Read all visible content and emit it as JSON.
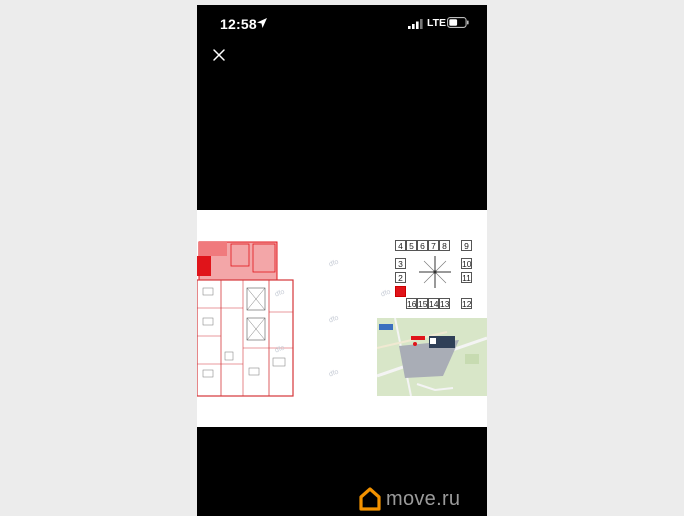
{
  "status_bar": {
    "time": "12:58",
    "network": "LTE"
  },
  "viewer": {
    "close_icon": "close-icon"
  },
  "plan": {
    "units_top": [
      "4",
      "5",
      "6",
      "7",
      "8",
      "9"
    ],
    "units_left": [
      "3",
      "2"
    ],
    "units_right": [
      "10",
      "11"
    ],
    "units_bottom": [
      "16",
      "15",
      "14",
      "13",
      "12"
    ],
    "active_unit": "1",
    "watermark": "dfo"
  },
  "brand": {
    "name": "move.ru",
    "accent": "#f39200"
  },
  "colors": {
    "highlight": "#e0141a",
    "background": "#000000"
  }
}
